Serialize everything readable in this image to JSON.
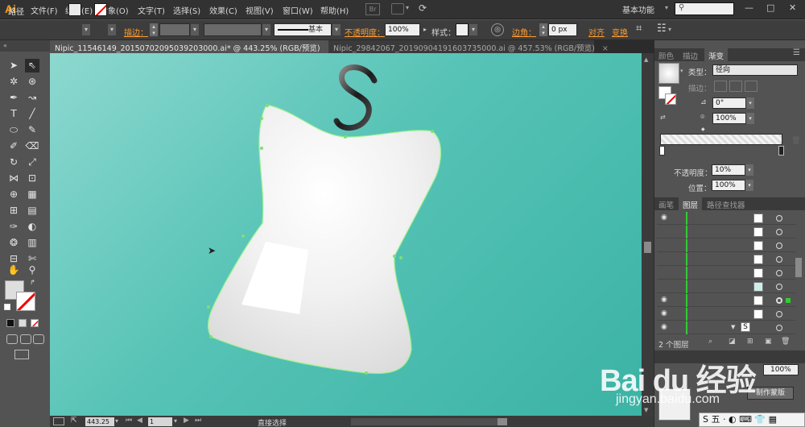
{
  "app": {
    "logo": "Ai"
  },
  "menu": [
    "文件(F)",
    "编辑(E)",
    "对象(O)",
    "文字(T)",
    "选择(S)",
    "效果(C)",
    "视图(V)",
    "窗口(W)",
    "帮助(H)"
  ],
  "menu_badge": "Br",
  "workspace": "基本功能",
  "window_buttons": [
    "—",
    "□",
    "✕"
  ],
  "control": {
    "object_type": "路径",
    "stroke_label": "描边：",
    "stroke_style": "基本",
    "opacity_label": "不透明度：",
    "opacity_value": "100%",
    "style_label": "样式：",
    "corner_label": "边角：",
    "corner_value": "0 px",
    "align_label": "对齐",
    "transform_label": "变换"
  },
  "tabs": [
    {
      "label": "Nipic_11546149_20150702095039203000.ai* @ 443.25% (RGB/预览)",
      "close": "×"
    },
    {
      "label": "Nipic_29842067_20190904191603735000.ai @ 457.53% (RGB/预览)",
      "close": "×"
    }
  ],
  "gradient_panel": {
    "tabs": [
      "颜色",
      "描边",
      "渐变"
    ],
    "type_label": "类型：",
    "type_value": "径向",
    "stroke_label": "描边：",
    "angle_value": "0°",
    "aspect_value": "100%",
    "opacity_label": "不透明度：",
    "opacity_value": "10%",
    "position_label": "位置：",
    "position_value": "100%"
  },
  "layers_panel": {
    "tabs": [
      "画笔",
      "图层",
      "路径查找器"
    ],
    "count": "2 个图层",
    "glyph": "S"
  },
  "transparency": {
    "opacity_value": "100%",
    "make_mask": "制作蒙版"
  },
  "status": {
    "zoom": "443.25",
    "page": "1",
    "tool": "直接选择"
  },
  "watermark": {
    "main": "Bai du 经验",
    "sub": "jingyan.baidu.com"
  },
  "ime": "S 五 · ◐ ⌨ 👕 ▦",
  "canvas": {
    "background_start": "#8dd8cf",
    "background_end": "#3bb3a5",
    "hook_glyph": "S"
  }
}
